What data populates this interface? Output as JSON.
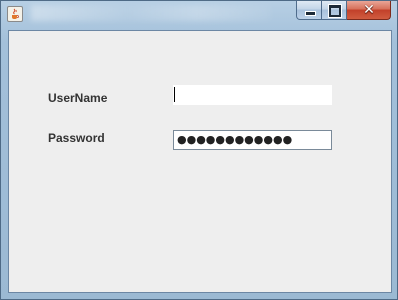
{
  "window": {
    "title": "",
    "app_icon": "java-cup-icon",
    "controls": {
      "minimize": "minimize-icon",
      "maximize": "maximize-icon",
      "close": "close-icon"
    }
  },
  "form": {
    "username_label": "UserName",
    "username_value": "",
    "password_label": "Password",
    "password_value": "●●●●●●●●●●●●"
  },
  "colors": {
    "client_background": "#eeeeee",
    "label_text": "#333333",
    "close_button": "#c2402a",
    "frame": "#a3c0da"
  }
}
